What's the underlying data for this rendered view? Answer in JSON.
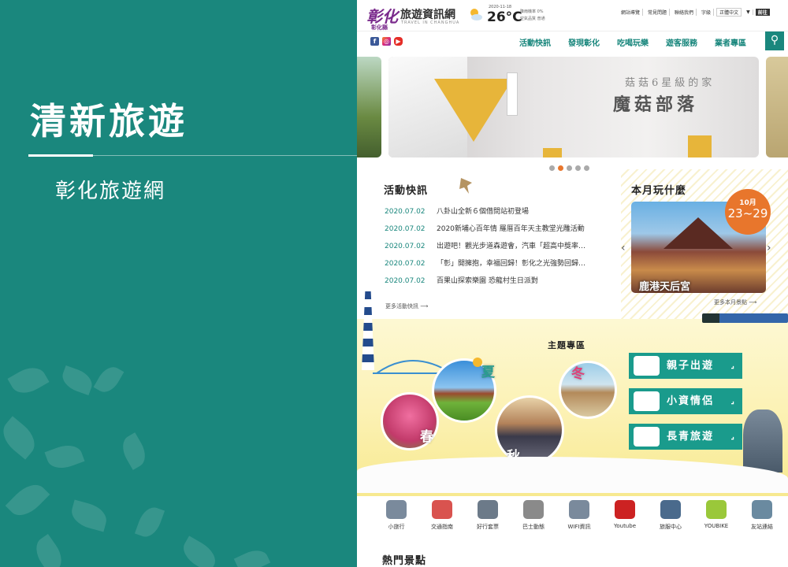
{
  "left_panel": {
    "title": "清新旅遊",
    "subtitle": "彰化旅遊網",
    "bg_color": "#1a877d"
  },
  "header": {
    "logo_mark": "彰化",
    "logo_mark_sub": "彰化縣",
    "logo_text": "旅遊資訊網",
    "logo_sub": "TRAVEL IN CHANGHUA",
    "weather": {
      "date": "2020-11-18",
      "temp": "26°C",
      "rain": "降雨機率 0%",
      "air": "空氣品質  普通",
      "icon": "partly-sunny-icon"
    },
    "top_links": [
      "網站導覽",
      "常見問題",
      "聯絡我們",
      "字級"
    ],
    "language": "正體中文",
    "go_label": "前往"
  },
  "nav": {
    "social": [
      "facebook-icon",
      "instagram-icon",
      "youtube-icon"
    ],
    "menu": [
      "活動快訊",
      "發現彰化",
      "吃喝玩樂",
      "遊客服務",
      "業者專區"
    ],
    "search_icon": "search-icon"
  },
  "banner": {
    "line1": "菇菇6星級的家",
    "line2": "魔菇部落",
    "active_dot": 1,
    "dot_count": 5
  },
  "news": {
    "title": "活動快訊",
    "items": [
      {
        "date": "2020.07.02",
        "text": "八卦山全新６個借問站初登場"
      },
      {
        "date": "2020.07.02",
        "text": "2020新埔心百年情 羅厝百年天主教堂光雕活動"
      },
      {
        "date": "2020.07.02",
        "text": "出遊吧！觀光步道森遊會，汽車「超高中獎率…"
      },
      {
        "date": "2020.07.02",
        "text": "「彰」開擁抱，幸福回歸！彰化之光強勢回歸…"
      },
      {
        "date": "2020.07.02",
        "text": "百果山探索樂園 恐龍村生日派對"
      }
    ],
    "more": "更多活動快訊"
  },
  "month": {
    "title": "本月玩什麼",
    "badge_month": "10月",
    "badge_range": "23~29",
    "place": "鹿港天后宮",
    "more": "更多本月景點"
  },
  "theme": {
    "title": "主題專區",
    "seasons": [
      "春",
      "夏",
      "秋",
      "冬"
    ],
    "buttons": [
      {
        "label": "親子出遊",
        "icon": "family-icon"
      },
      {
        "label": "小資情侶",
        "icon": "heart-icon"
      },
      {
        "label": "長青旅遊",
        "icon": "elderly-icon"
      }
    ]
  },
  "quick_links": [
    {
      "label": "小旅行",
      "icon": "traveler-icon",
      "color": "#7a8a9c"
    },
    {
      "label": "交通指南",
      "icon": "map-pin-icon",
      "color": "#d9534f"
    },
    {
      "label": "好行套票",
      "icon": "bus-ticket-icon",
      "color": "#6c7a89"
    },
    {
      "label": "巴士動態",
      "icon": "bus-icon",
      "color": "#8a8a8a"
    },
    {
      "label": "WIFI資訊",
      "icon": "wifi-icon",
      "color": "#7a8a9c"
    },
    {
      "label": "Youtube",
      "icon": "youtube-icon",
      "color": "#cc2222"
    },
    {
      "label": "旅服中心",
      "icon": "service-center-icon",
      "color": "#4a6a8c"
    },
    {
      "label": "YOUBIKE",
      "icon": "bike-icon",
      "color": "#9ac83a"
    },
    {
      "label": "友站連結",
      "icon": "globe-icon",
      "color": "#6a8aa0"
    }
  ],
  "hot": {
    "title": "熱門景點"
  }
}
